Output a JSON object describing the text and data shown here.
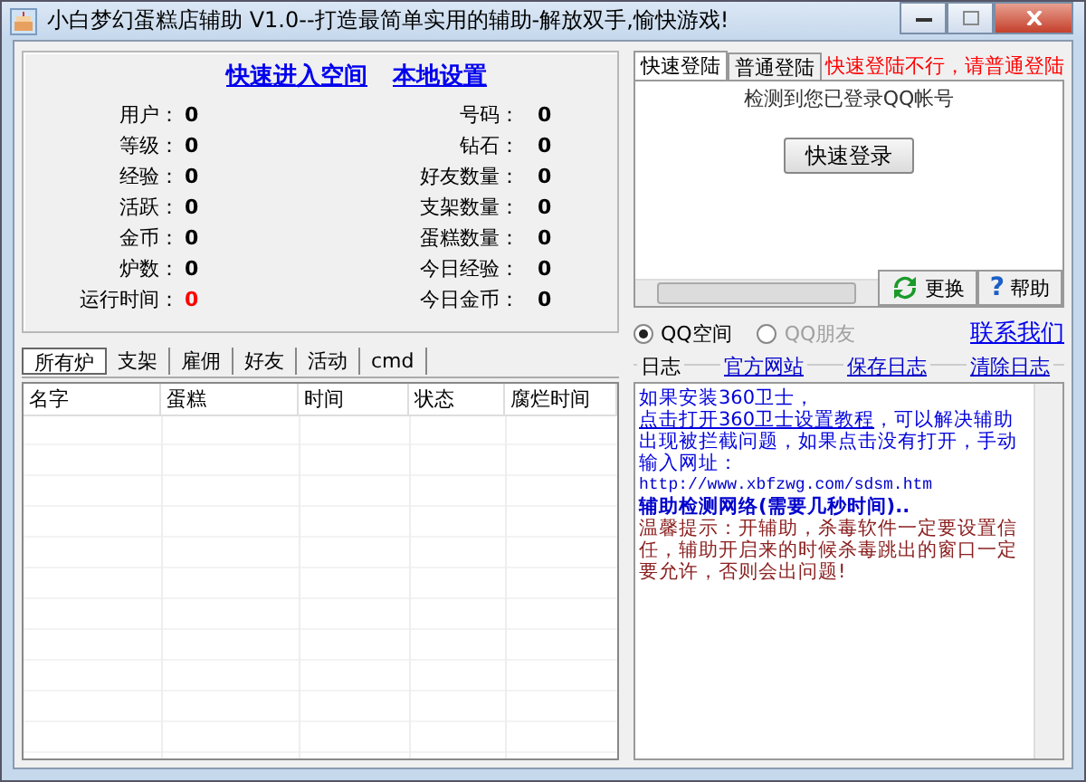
{
  "window": {
    "title": "小白梦幻蛋糕店辅助 V1.0--打造最简单实用的辅助-解放双手,愉快游戏!"
  },
  "links": [
    "快速进入空间",
    "本地设置"
  ],
  "stats_left": [
    {
      "label": "用户：",
      "value": "0",
      "alert": false
    },
    {
      "label": "等级：",
      "value": "0",
      "alert": false
    },
    {
      "label": "经验：",
      "value": "0",
      "alert": false
    },
    {
      "label": "活跃：",
      "value": "0",
      "alert": false
    },
    {
      "label": "金币：",
      "value": "0",
      "alert": false
    },
    {
      "label": "炉数：",
      "value": "0",
      "alert": false
    },
    {
      "label": "运行时间：",
      "value": "0",
      "alert": true
    }
  ],
  "stats_right": [
    {
      "label": "号码：",
      "value": "0",
      "alert": false
    },
    {
      "label": "钻石：",
      "value": "0",
      "alert": false
    },
    {
      "label": "好友数量：",
      "value": "0",
      "alert": false
    },
    {
      "label": "支架数量：",
      "value": "0",
      "alert": false
    },
    {
      "label": "蛋糕数量：",
      "value": "0",
      "alert": false
    },
    {
      "label": "今日经验：",
      "value": "0",
      "alert": false
    },
    {
      "label": "今日金币：",
      "value": "0",
      "alert": false
    }
  ],
  "login_tabs": [
    {
      "label": "快速登陆",
      "selected": true
    },
    {
      "label": "普通登陆",
      "selected": false
    }
  ],
  "login_hint": "快速登陆不行，请普通登陆",
  "login_panel": {
    "status": "检测到您已登录QQ帐号",
    "login_button": "快速登录",
    "change_button": "更换",
    "help_button": "帮助",
    "help_icon": "?"
  },
  "mode_options": [
    {
      "label": "QQ空间",
      "selected": true,
      "disabled": false
    },
    {
      "label": "QQ朋友",
      "selected": false,
      "disabled": true
    }
  ],
  "contact_link": "联系我们",
  "log": {
    "title": "日志",
    "links": [
      "官方网站",
      "保存日志",
      "清除日志"
    ],
    "entries": [
      {
        "kind": "notice",
        "before": "如果安装360卫士，",
        "link": "点击打开360卫士设置教程",
        "after": "，可以解决辅助出现被拦截问题，如果点击没有打开，手动输入网址："
      },
      {
        "kind": "url",
        "text": "http://www.xbfzwg.com/sdsm.htm"
      },
      {
        "kind": "status",
        "text": "辅助检测网络(需要几秒时间).."
      },
      {
        "kind": "warning",
        "text": "温馨提示：开辅助，杀毒软件一定要设置信任，辅助开启来的时候杀毒跳出的窗口一定要允许，否则会出问题!"
      }
    ]
  },
  "list_tabs": [
    {
      "label": "所有炉",
      "selected": true
    },
    {
      "label": "支架",
      "selected": false
    },
    {
      "label": "雇佣",
      "selected": false
    },
    {
      "label": "好友",
      "selected": false
    },
    {
      "label": "活动",
      "selected": false
    },
    {
      "label": "cmd",
      "selected": false
    }
  ],
  "table": {
    "columns": [
      "名字",
      "蛋糕",
      "时间",
      "状态",
      "腐烂时间"
    ]
  }
}
